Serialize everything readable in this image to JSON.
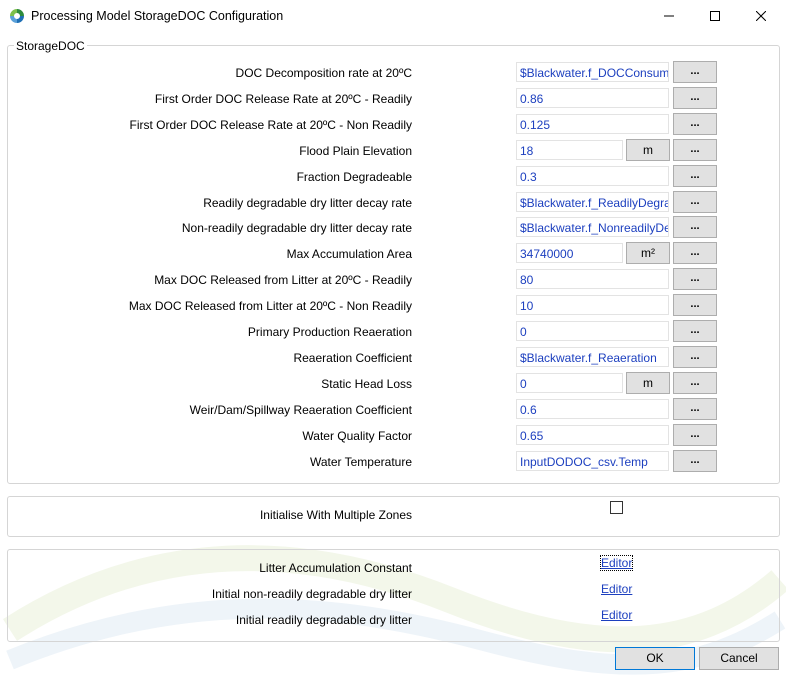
{
  "window": {
    "title": "Processing Model StorageDOC Configuration",
    "minimize_icon": "minimize-icon",
    "maximize_icon": "maximize-icon",
    "close_icon": "close-icon"
  },
  "group": {
    "title": "StorageDOC"
  },
  "parameters": [
    {
      "label": "DOC Decomposition rate at 20ºC",
      "value": "$Blackwater.f_DOCConsump",
      "unit": "",
      "button": "..."
    },
    {
      "label": "First Order DOC Release Rate at 20ºC - Readily",
      "value": "0.86",
      "unit": "",
      "button": "..."
    },
    {
      "label": "First Order DOC Release Rate at 20ºC - Non Readily",
      "value": "0.125",
      "unit": "",
      "button": "..."
    },
    {
      "label": "Flood Plain Elevation",
      "value": "18",
      "unit": "m",
      "button": "..."
    },
    {
      "label": "Fraction Degradeable",
      "value": "0.3",
      "unit": "",
      "button": "..."
    },
    {
      "label": "Readily degradable dry litter decay rate",
      "value": "$Blackwater.f_ReadilyDegrad",
      "unit": "",
      "button": "..."
    },
    {
      "label": "Non-readily degradable dry litter decay rate",
      "value": "$Blackwater.f_NonreadilyDe",
      "unit": "",
      "button": "..."
    },
    {
      "label": "Max Accumulation Area",
      "value": "34740000",
      "unit": "m²",
      "button": "..."
    },
    {
      "label": "Max DOC Released from Litter at 20ºC - Readily",
      "value": "80",
      "unit": "",
      "button": "..."
    },
    {
      "label": "Max DOC Released from Litter at 20ºC - Non Readily",
      "value": "10",
      "unit": "",
      "button": "..."
    },
    {
      "label": "Primary Production Reaeration",
      "value": "0",
      "unit": "",
      "button": "..."
    },
    {
      "label": "Reaeration Coefficient",
      "value": "$Blackwater.f_Reaeration",
      "unit": "",
      "button": "..."
    },
    {
      "label": "Static Head Loss",
      "value": "0",
      "unit": "m",
      "button": "..."
    },
    {
      "label": "Weir/Dam/Spillway Reaeration Coefficient",
      "value": "0.6",
      "unit": "",
      "button": "..."
    },
    {
      "label": "Water Quality Factor",
      "value": "0.65",
      "unit": "",
      "button": "..."
    },
    {
      "label": "Water Temperature",
      "value": "InputDODOC_csv.Temp",
      "unit": "",
      "button": "..."
    }
  ],
  "zones": {
    "label": "Initialise With Multiple Zones",
    "checked": false
  },
  "editors": [
    {
      "label": "Litter Accumulation Constant",
      "link": "Editor"
    },
    {
      "label": "Initial non-readily degradable dry litter",
      "link": "Editor"
    },
    {
      "label": "Initial readily degradable dry litter",
      "link": "Editor"
    }
  ],
  "buttons": {
    "ok": "OK",
    "cancel": "Cancel"
  },
  "colors": {
    "value_text": "#1c3fbf",
    "accent": "#0078d7"
  }
}
